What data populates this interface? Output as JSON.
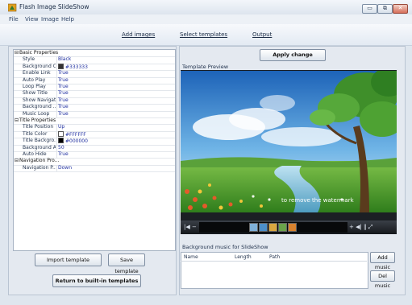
{
  "window": {
    "title": "Flash Image SlideShow",
    "btn_minimize": "▭",
    "btn_restore": "⧉",
    "btn_close": "✕"
  },
  "menu": [
    "File",
    "View",
    "Image",
    "Help"
  ],
  "toolbar": {
    "add_images": "Add images",
    "select_templates": "Select templates",
    "output": "Output"
  },
  "properties": [
    {
      "type": "category",
      "expander": "⊟",
      "name": "Basic Properties",
      "value": ""
    },
    {
      "type": "item",
      "name": "Style",
      "value": "Black"
    },
    {
      "type": "item",
      "name": "Background C...",
      "value": "#333333",
      "swatch": "#333333"
    },
    {
      "type": "item",
      "name": "Enable Link",
      "value": "True"
    },
    {
      "type": "item",
      "name": "Auto Play",
      "value": "True"
    },
    {
      "type": "item",
      "name": "Loop Play",
      "value": "True"
    },
    {
      "type": "item",
      "name": "Show Title",
      "value": "True"
    },
    {
      "type": "item",
      "name": "Show Navigat...",
      "value": "True"
    },
    {
      "type": "item",
      "name": "Background ...",
      "value": "True"
    },
    {
      "type": "item",
      "name": "Music Loop",
      "value": "True"
    },
    {
      "type": "category",
      "expander": "⊟",
      "name": "Title Properties",
      "value": ""
    },
    {
      "type": "item",
      "name": "Title Position",
      "value": "Up"
    },
    {
      "type": "item",
      "name": "Title Color",
      "value": "#FFFFFF",
      "swatch": "#FFFFFF"
    },
    {
      "type": "item",
      "name": "Title Backgro...",
      "value": "#000000",
      "swatch": "#000000"
    },
    {
      "type": "item",
      "name": "Background A...",
      "value": "50"
    },
    {
      "type": "item",
      "name": "Auto Hide",
      "value": "True"
    },
    {
      "type": "category",
      "expander": "⊟",
      "name": "Navigation Pro...",
      "value": ""
    },
    {
      "type": "item",
      "name": "Navigation P...",
      "value": "Down"
    }
  ],
  "buttons": {
    "import_template": "Import template",
    "save_template": "Save template",
    "return_builtin": "Return to built-in templates",
    "apply_change": "Apply change",
    "add_music": "Add music",
    "del_music": "Del music"
  },
  "preview": {
    "label": "Template Preview",
    "watermark": "to remove the watermark",
    "ctrl_left": "|◀  −",
    "ctrl_right": "+  ◀|  ‖  ⤢",
    "thumb_colors": [
      "#7fb0d8",
      "#4c8fca",
      "#d9a640",
      "#6aa34a",
      "#d8822e"
    ]
  },
  "music": {
    "label": "Background music for SlideShow",
    "columns": [
      "Name",
      "Length",
      "Path"
    ]
  }
}
